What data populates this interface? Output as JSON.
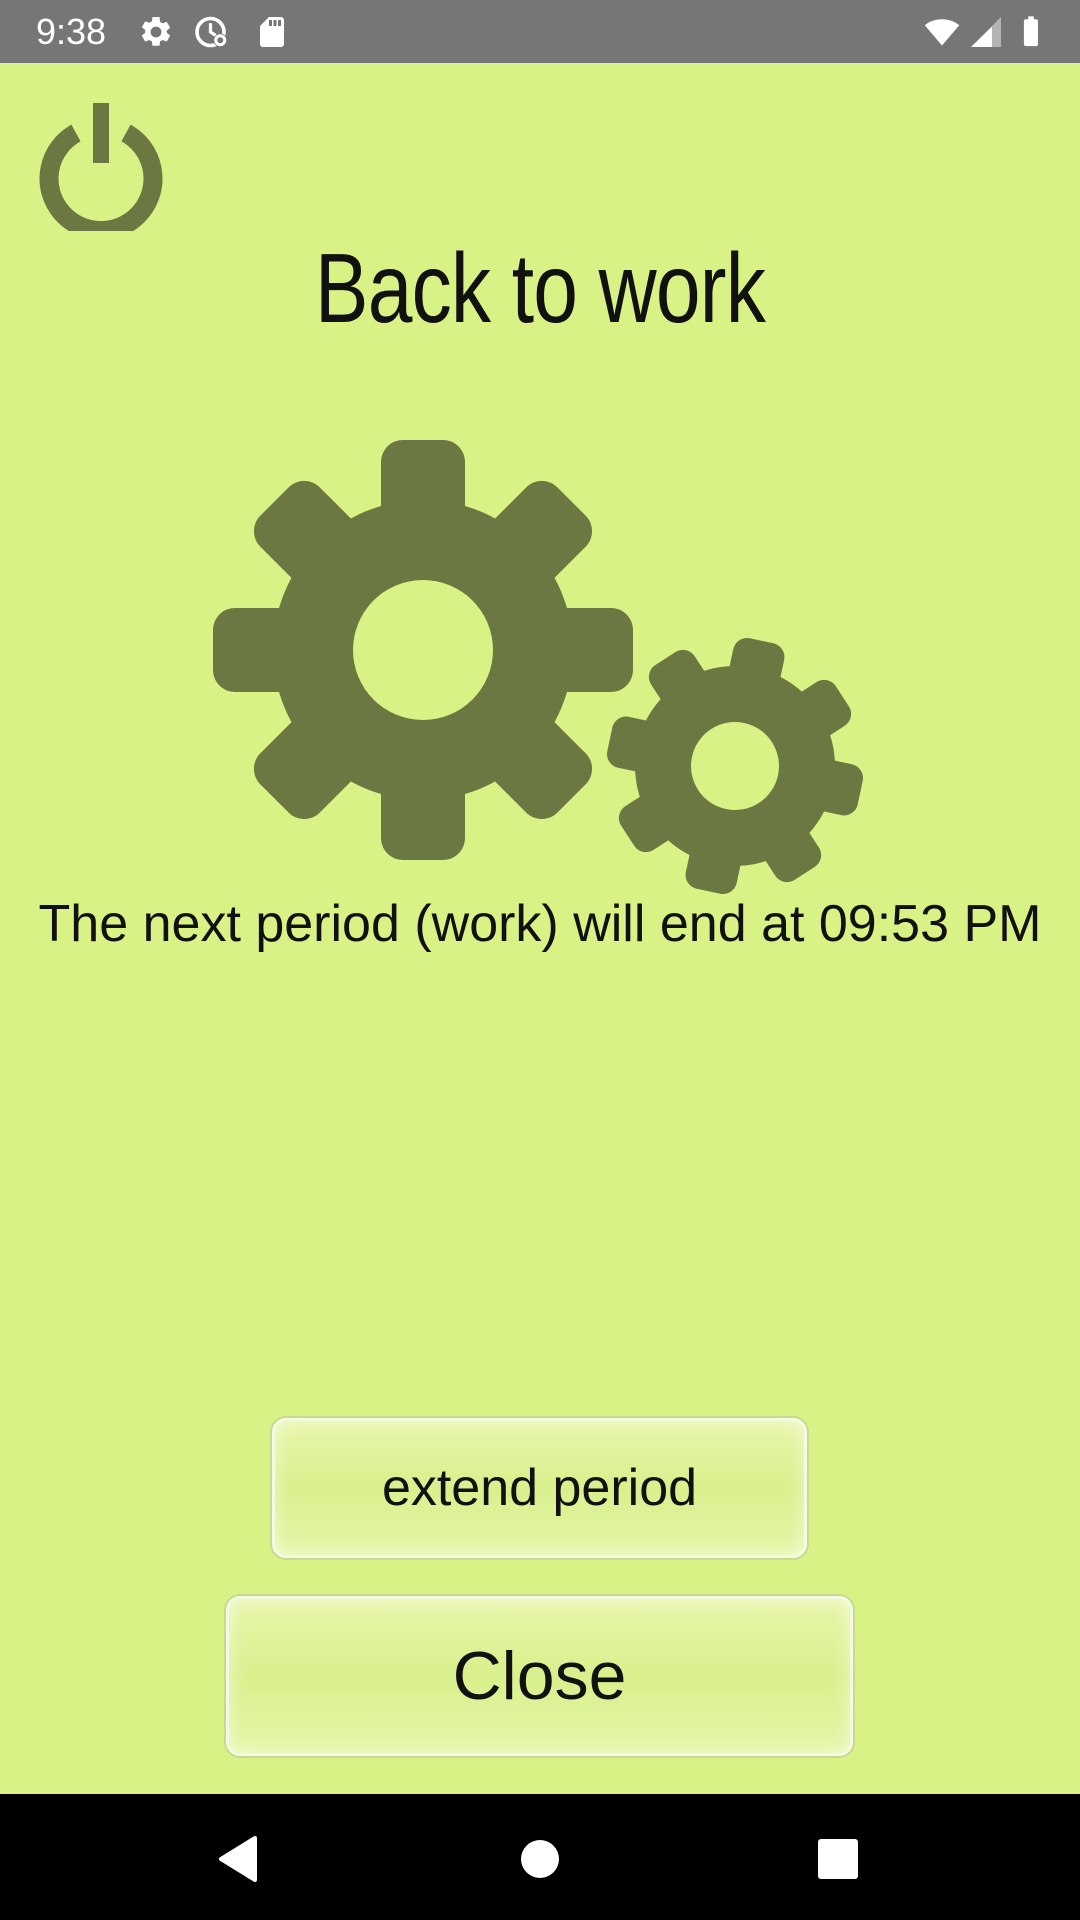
{
  "status_bar": {
    "time": "9:38",
    "left_icons": [
      "gear-icon",
      "clock-settings-icon",
      "sd-card-icon"
    ],
    "right_icons": [
      "wifi-icon",
      "signal-icon",
      "battery-icon"
    ]
  },
  "header": {
    "power_icon": "power-icon",
    "title": "Back to work"
  },
  "illustration": {
    "icon": "gears-icon",
    "color": "#6c7841"
  },
  "message": "The next period (work) will end at 09:53 PM",
  "buttons": {
    "extend_label": "extend period",
    "close_label": "Close"
  },
  "nav_bar": {
    "icons": [
      "back-icon",
      "home-icon",
      "recents-icon"
    ]
  },
  "colors": {
    "background": "#d8f285",
    "accent": "#6c7841",
    "status_bar": "#767676",
    "nav_bar": "#000000"
  }
}
